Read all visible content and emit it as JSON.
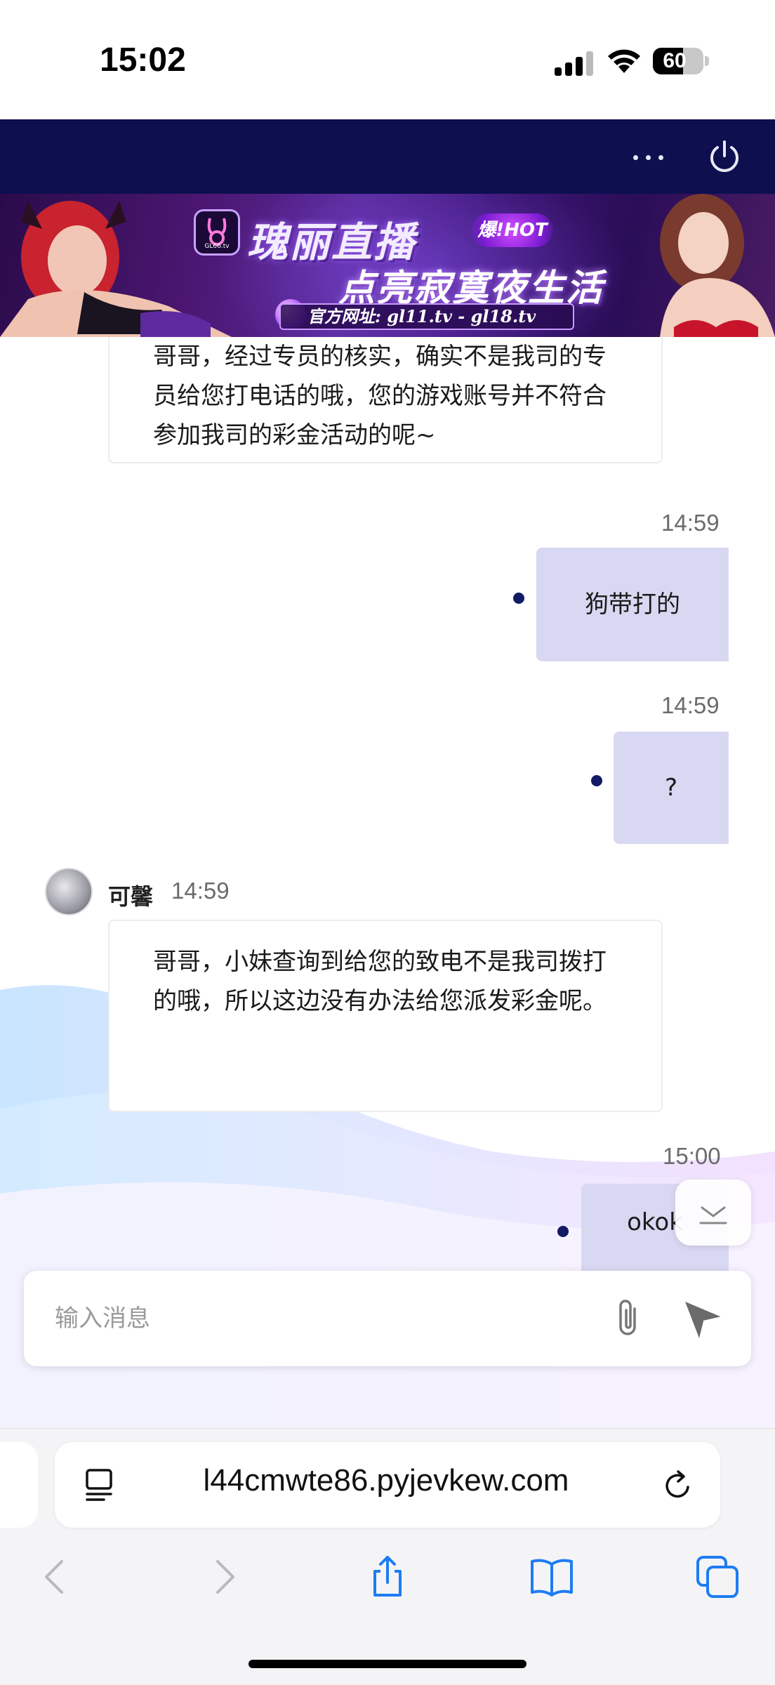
{
  "status_bar": {
    "time": "15:02",
    "battery": "60",
    "battery_level": 0.6
  },
  "banner": {
    "title_line1": "瑰丽直播",
    "hot_badge": "爆!HOT",
    "title_line2": "点亮寂寞夜生活",
    "url_text": "官方网址: gl11.tv - gl18.tv",
    "logo_text": "GL66.tv"
  },
  "chat": {
    "messages": [
      {
        "type": "in",
        "text": "哥哥，经过专员的核实，确实不是我司的专员给您打电话的哦，您的游戏账号并不符合参加我司的彩金活动的呢~"
      },
      {
        "type": "out",
        "time": "14:59",
        "text": "狗带打的"
      },
      {
        "type": "out",
        "time": "14:59",
        "text": "?"
      },
      {
        "type": "in",
        "sender": "可馨",
        "time": "14:59",
        "text": "哥哥，小妹查询到给您的致电不是我司拨打的哦，所以这边没有办法给您派发彩金呢。"
      },
      {
        "type": "out",
        "time": "15:00",
        "text": "okok"
      }
    ]
  },
  "input": {
    "placeholder": "输入消息"
  },
  "browser": {
    "url": "l44cmwte86.pyjevkew.com"
  },
  "colors": {
    "header_bg": "#0d0f4f",
    "outgoing_bubble": "#d9d8f2",
    "dot": "#131a64"
  }
}
